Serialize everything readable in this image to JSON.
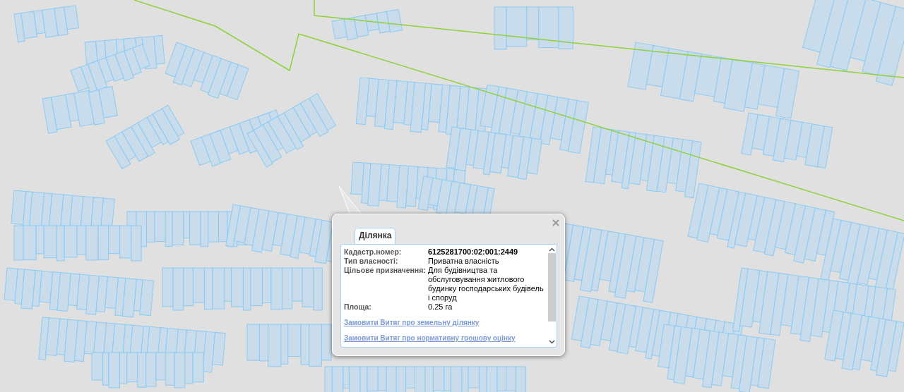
{
  "popup": {
    "tabs": [
      {
        "label": "Ділянка",
        "selected": true
      }
    ],
    "fields": [
      {
        "label": "Кадастр.номер:",
        "value": "6125281700:02:001:2449",
        "kind": "number"
      },
      {
        "label": "Тип власності:",
        "value": "Приватна власність",
        "kind": "text"
      },
      {
        "label": "Цільове призначення:",
        "value": "Для будівництва та обслуговування житлового будинку господарських будівель і споруд",
        "kind": "text"
      },
      {
        "label": "Площа:",
        "value": "0.25 га",
        "kind": "text"
      }
    ],
    "links": [
      "Замовити Витяг про земельну ділянку",
      "Замовити Витяг про нормативну грошову оцінку"
    ]
  }
}
